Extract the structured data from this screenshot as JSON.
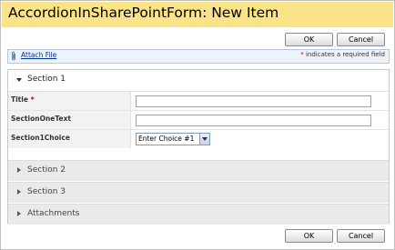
{
  "page": {
    "title": "AccordionInSharePointForm: New Item"
  },
  "top_actions": {
    "ok_label": "OK",
    "cancel_label": "Cancel"
  },
  "toolbar": {
    "attach_label": "Attach File",
    "required_star": "*",
    "required_note": "indicates a required field",
    "icon": "paperclip-icon"
  },
  "sections": [
    {
      "label": "Section 1",
      "expanded": true
    },
    {
      "label": "Section 2",
      "expanded": false
    },
    {
      "label": "Section 3",
      "expanded": false
    },
    {
      "label": "Attachments",
      "expanded": false
    }
  ],
  "fields": {
    "title": {
      "label": "Title",
      "required_mark": "*",
      "value": ""
    },
    "section_one_text": {
      "label": "SectionOneText",
      "value": ""
    },
    "section1_choice": {
      "label": "Section1Choice",
      "selected": "Enter Choice #1"
    }
  },
  "bottom_actions": {
    "ok_label": "OK",
    "cancel_label": "Cancel"
  },
  "colors": {
    "title_bar": "#fbe38a",
    "required": "#cc0000",
    "link": "#003399",
    "toolbar_bg": "#eef3fa"
  }
}
